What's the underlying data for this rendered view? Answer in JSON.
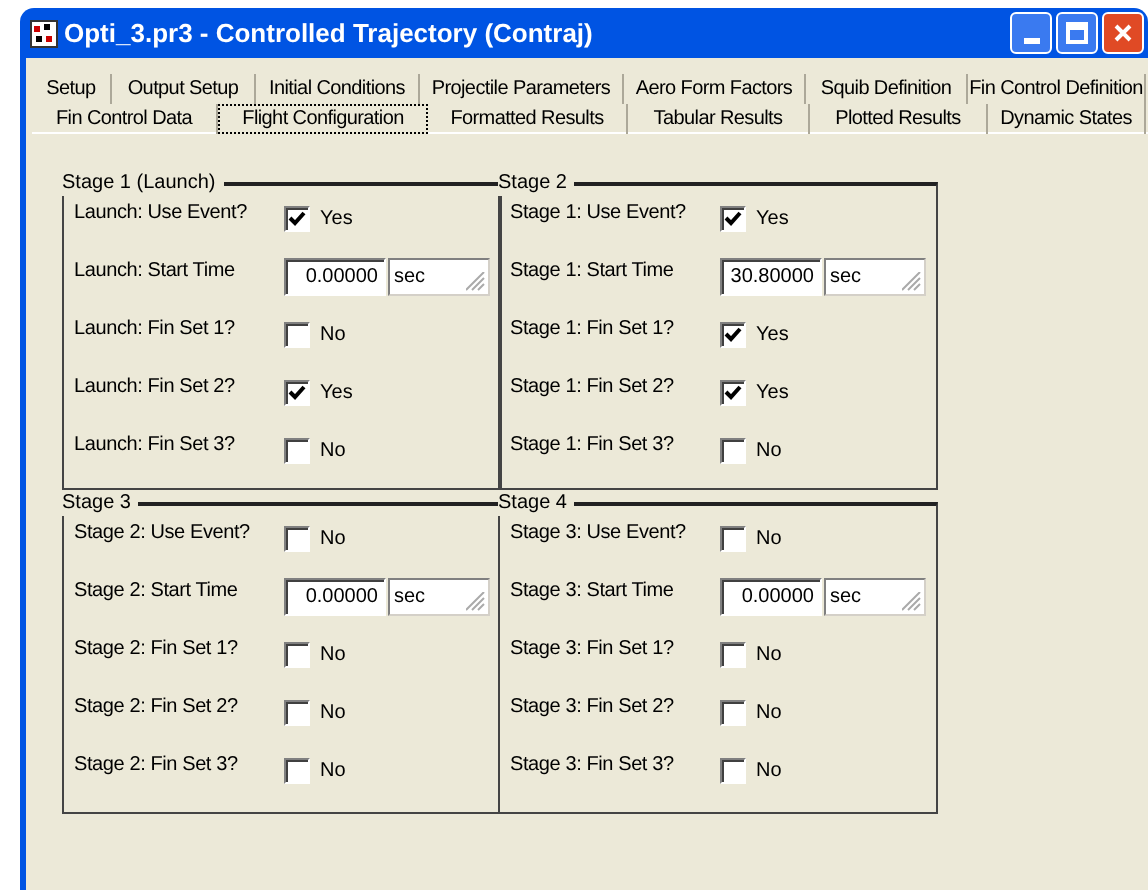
{
  "window": {
    "title": "Opti_3.pr3 - Controlled Trajectory (Contraj)"
  },
  "tab_rows": [
    [
      {
        "label": "Setup",
        "selected": false
      },
      {
        "label": "Output Setup",
        "selected": false
      },
      {
        "label": "Initial Conditions",
        "selected": false
      },
      {
        "label": "Projectile Parameters",
        "selected": false
      },
      {
        "label": "Aero Form Factors",
        "selected": false
      },
      {
        "label": "Squib Definition",
        "selected": false
      },
      {
        "label": "Fin Control Definition",
        "selected": false
      }
    ],
    [
      {
        "label": "Fin Control Data",
        "selected": false
      },
      {
        "label": "Flight Configuration",
        "selected": true
      },
      {
        "label": "Formatted Results",
        "selected": false
      },
      {
        "label": "Tabular Results",
        "selected": false
      },
      {
        "label": "Plotted Results",
        "selected": false
      },
      {
        "label": "Dynamic States",
        "selected": false
      }
    ]
  ],
  "stages": [
    {
      "title": "Stage 1 (Launch)",
      "rows": [
        {
          "kind": "checkbox",
          "label": "Launch: Use Event?",
          "checked": true,
          "text": "Yes"
        },
        {
          "kind": "time",
          "label": "Launch: Start Time",
          "value": "0.00000",
          "unit": "sec"
        },
        {
          "kind": "checkbox",
          "label": "Launch: Fin Set 1?",
          "checked": false,
          "text": "No"
        },
        {
          "kind": "checkbox",
          "label": "Launch: Fin Set 2?",
          "checked": true,
          "text": "Yes"
        },
        {
          "kind": "checkbox",
          "label": "Launch: Fin Set 3?",
          "checked": false,
          "text": "No"
        }
      ]
    },
    {
      "title": "Stage 2",
      "rows": [
        {
          "kind": "checkbox",
          "label": "Stage 1: Use Event?",
          "checked": true,
          "text": "Yes"
        },
        {
          "kind": "time",
          "label": "Stage 1: Start Time",
          "value": "30.80000",
          "unit": "sec"
        },
        {
          "kind": "checkbox",
          "label": "Stage 1: Fin Set 1?",
          "checked": true,
          "text": "Yes"
        },
        {
          "kind": "checkbox",
          "label": "Stage 1: Fin Set 2?",
          "checked": true,
          "text": "Yes"
        },
        {
          "kind": "checkbox",
          "label": "Stage 1: Fin Set 3?",
          "checked": false,
          "text": "No"
        }
      ]
    },
    {
      "title": "Stage 3",
      "rows": [
        {
          "kind": "checkbox",
          "label": "Stage 2: Use Event?",
          "checked": false,
          "text": "No"
        },
        {
          "kind": "time",
          "label": "Stage 2: Start Time",
          "value": "0.00000",
          "unit": "sec"
        },
        {
          "kind": "checkbox",
          "label": "Stage 2: Fin Set 1?",
          "checked": false,
          "text": "No"
        },
        {
          "kind": "checkbox",
          "label": "Stage 2: Fin Set 2?",
          "checked": false,
          "text": "No"
        },
        {
          "kind": "checkbox",
          "label": "Stage 2: Fin Set 3?",
          "checked": false,
          "text": "No"
        }
      ]
    },
    {
      "title": "Stage 4",
      "rows": [
        {
          "kind": "checkbox",
          "label": "Stage 3: Use Event?",
          "checked": false,
          "text": "No"
        },
        {
          "kind": "time",
          "label": "Stage 3: Start Time",
          "value": "0.00000",
          "unit": "sec"
        },
        {
          "kind": "checkbox",
          "label": "Stage 3: Fin Set 1?",
          "checked": false,
          "text": "No"
        },
        {
          "kind": "checkbox",
          "label": "Stage 3: Fin Set 2?",
          "checked": false,
          "text": "No"
        },
        {
          "kind": "checkbox",
          "label": "Stage 3: Fin Set 3?",
          "checked": false,
          "text": "No"
        }
      ]
    }
  ]
}
